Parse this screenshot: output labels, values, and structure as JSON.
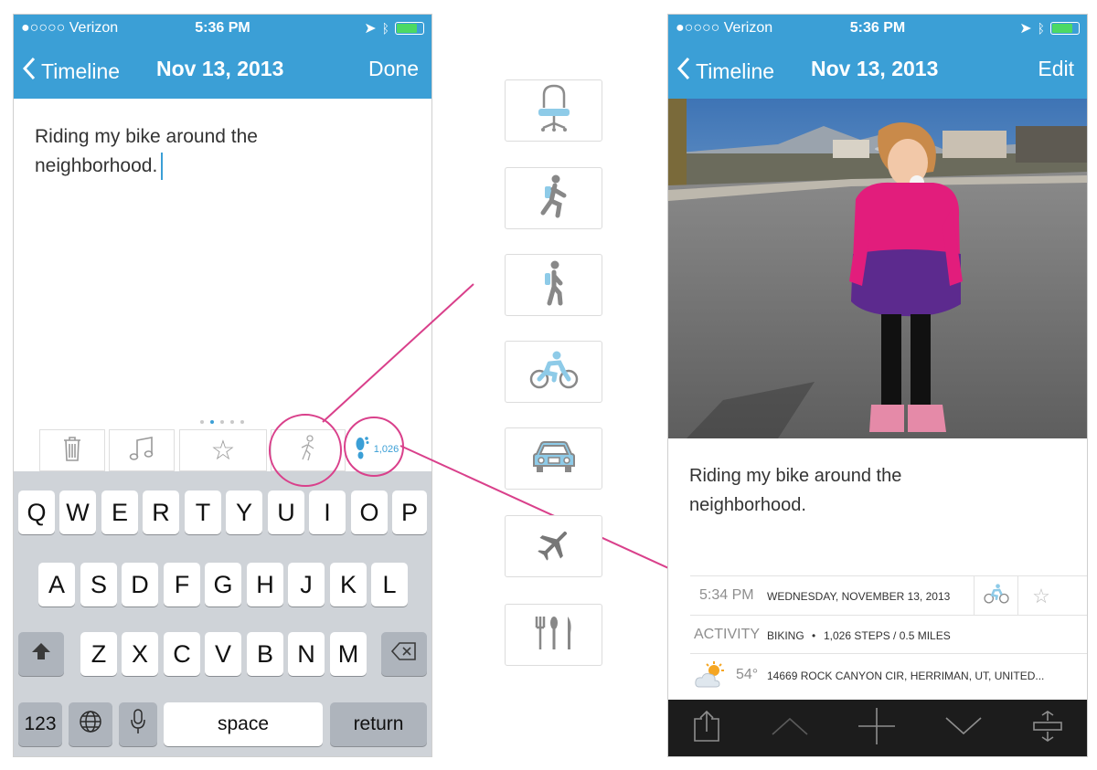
{
  "status_bar": {
    "carrier": "●○○○○ Verizon",
    "time": "5:36 PM"
  },
  "left_screen": {
    "nav": {
      "back_label": "Timeline",
      "title": "Nov 13, 2013",
      "action_label": "Done"
    },
    "note_text_line1": "Riding my bike around the",
    "note_text_line2": "neighborhood.",
    "toolbar": {
      "steps_count": "1,026"
    },
    "keyboard": {
      "row1": [
        "Q",
        "W",
        "E",
        "R",
        "T",
        "Y",
        "U",
        "I",
        "O",
        "P"
      ],
      "row2": [
        "A",
        "S",
        "D",
        "F",
        "G",
        "H",
        "J",
        "K",
        "L"
      ],
      "row3": [
        "Z",
        "X",
        "C",
        "V",
        "B",
        "N",
        "M"
      ],
      "numbers_label": "123",
      "space_label": "space",
      "return_label": "return"
    }
  },
  "activity_options": [
    "stationary",
    "running",
    "walking",
    "biking",
    "automotive",
    "flying",
    "eating"
  ],
  "right_screen": {
    "nav": {
      "back_label": "Timeline",
      "title": "Nov 13, 2013",
      "action_label": "Edit"
    },
    "note_text_line1": "Riding my bike around the",
    "note_text_line2": "neighborhood.",
    "meta": {
      "time": "5:34 PM",
      "date": "WEDNESDAY, NOVEMBER 13, 2013",
      "activity_label": "ACTIVITY",
      "activity_value": "BIKING",
      "activity_separator": "•",
      "activity_detail": "1,026 STEPS / 0.5 MILES",
      "temperature": "54°",
      "location": "14669 ROCK CANYON CIR, HERRIMAN, UT, UNITED..."
    }
  },
  "colors": {
    "accent": "#3b9fd6",
    "callout": "#d9408b",
    "bottom_bar": "#1c1c1c"
  }
}
